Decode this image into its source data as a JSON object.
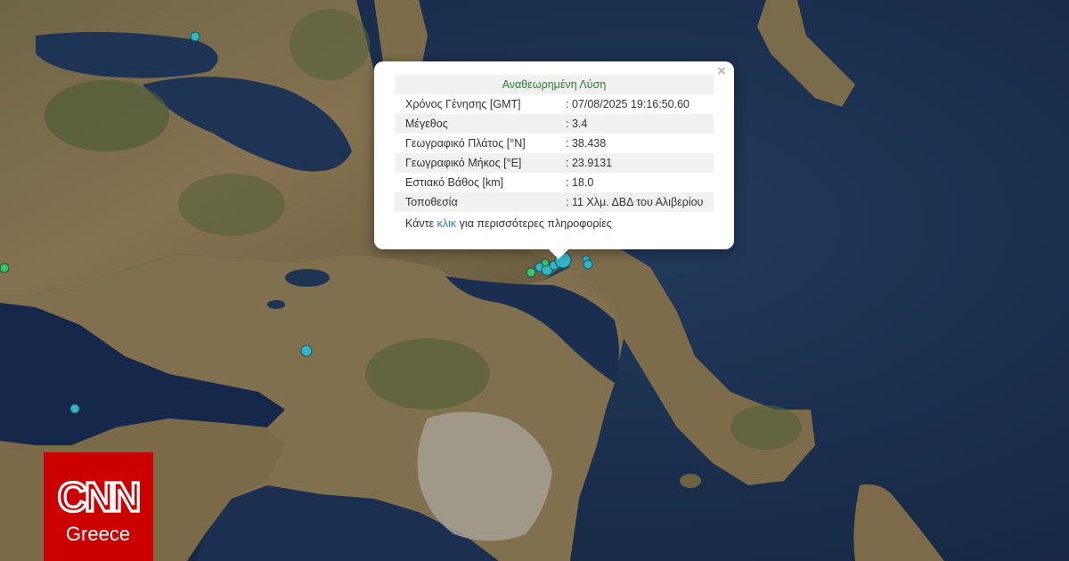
{
  "popup": {
    "title": "Αναθεωρημένη Λύση",
    "rows": [
      {
        "label": "Χρόνος Γένησης [GMT]",
        "value": ": 07/08/2025 19:16:50.60"
      },
      {
        "label": "Μέγεθος",
        "value": ": 3.4"
      },
      {
        "label": "Γεωγραφικό Πλάτος [°N]",
        "value": ": 38.438"
      },
      {
        "label": "Γεωγραφικό Μήκος [°E]",
        "value": ": 23.9131"
      },
      {
        "label": "Εστιακό Βάθος [km]",
        "value": ": 18.0"
      },
      {
        "label": "Τοποθεσία",
        "value": ": 11 Χλμ. ΔΒΔ του Αλιβερίου"
      }
    ],
    "more_prefix": "Κάντε ",
    "more_link": "κλικ",
    "more_suffix": " για περισσότερες πληροφορίες",
    "close_symbol": "×"
  },
  "logo": {
    "brand": "CNN",
    "edition": "Greece",
    "color": "#cc0000"
  },
  "colors": {
    "sea": "#1d3350",
    "land": "#7a6a48",
    "marker": "#33b5c8"
  }
}
